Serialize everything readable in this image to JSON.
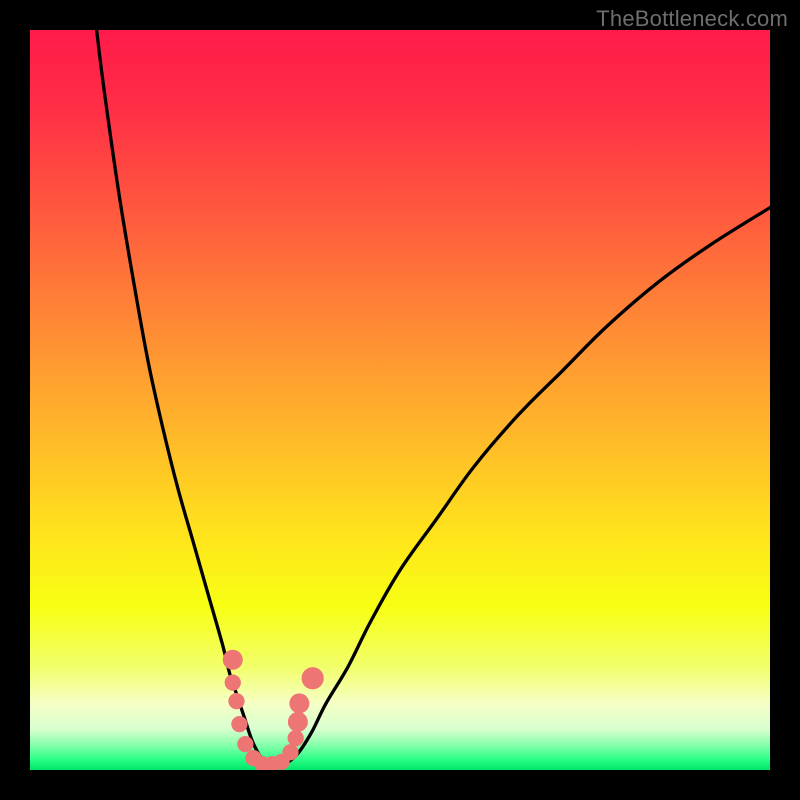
{
  "watermark": {
    "text": "TheBottleneck.com"
  },
  "colors": {
    "black": "#000000",
    "curve": "#000000",
    "marker": "#ed7573",
    "gradient_stops": [
      {
        "offset": 0.0,
        "color": "#ff1b4a"
      },
      {
        "offset": 0.1,
        "color": "#ff2d46"
      },
      {
        "offset": 0.25,
        "color": "#ff5a3e"
      },
      {
        "offset": 0.4,
        "color": "#ff8a35"
      },
      {
        "offset": 0.55,
        "color": "#ffb92a"
      },
      {
        "offset": 0.68,
        "color": "#ffe31c"
      },
      {
        "offset": 0.78,
        "color": "#f7ff14"
      },
      {
        "offset": 0.86,
        "color": "#f2ff6a"
      },
      {
        "offset": 0.91,
        "color": "#f6ffc5"
      },
      {
        "offset": 0.945,
        "color": "#d7ffcf"
      },
      {
        "offset": 0.965,
        "color": "#8cffad"
      },
      {
        "offset": 0.985,
        "color": "#2dff87"
      },
      {
        "offset": 1.0,
        "color": "#00e56a"
      }
    ]
  },
  "chart_data": {
    "type": "line",
    "title": "",
    "xlabel": "",
    "ylabel": "",
    "xlim": [
      0,
      100
    ],
    "ylim": [
      0,
      100
    ],
    "series": [
      {
        "name": "left-curve",
        "x": [
          9,
          10,
          12,
          14,
          16,
          18,
          20,
          22,
          24,
          26,
          27,
          28,
          29,
          30,
          31,
          32
        ],
        "y": [
          100,
          92,
          78,
          66,
          55,
          46,
          38,
          31,
          24,
          17,
          13,
          10,
          7,
          4,
          2,
          0.5
        ]
      },
      {
        "name": "right-curve",
        "x": [
          34,
          36,
          38,
          40,
          43,
          46,
          50,
          55,
          60,
          66,
          72,
          78,
          85,
          92,
          100
        ],
        "y": [
          0.5,
          2,
          5,
          9,
          14,
          20,
          27,
          34,
          41,
          48,
          54,
          60,
          66,
          71,
          76
        ]
      },
      {
        "name": "markers",
        "style": "dots",
        "x": [
          27.4,
          27.4,
          27.9,
          28.3,
          29.1,
          30.2,
          31.4,
          32.7,
          34.0,
          35.2,
          35.9,
          36.2,
          36.4,
          38.2
        ],
        "y": [
          14.9,
          11.8,
          9.3,
          6.2,
          3.5,
          1.6,
          0.8,
          0.8,
          1.1,
          2.4,
          4.3,
          6.5,
          9.0,
          12.4
        ],
        "r": [
          1.35,
          1.1,
          1.1,
          1.1,
          1.1,
          1.1,
          1.1,
          1.1,
          1.1,
          1.1,
          1.1,
          1.35,
          1.35,
          1.5
        ]
      }
    ]
  }
}
